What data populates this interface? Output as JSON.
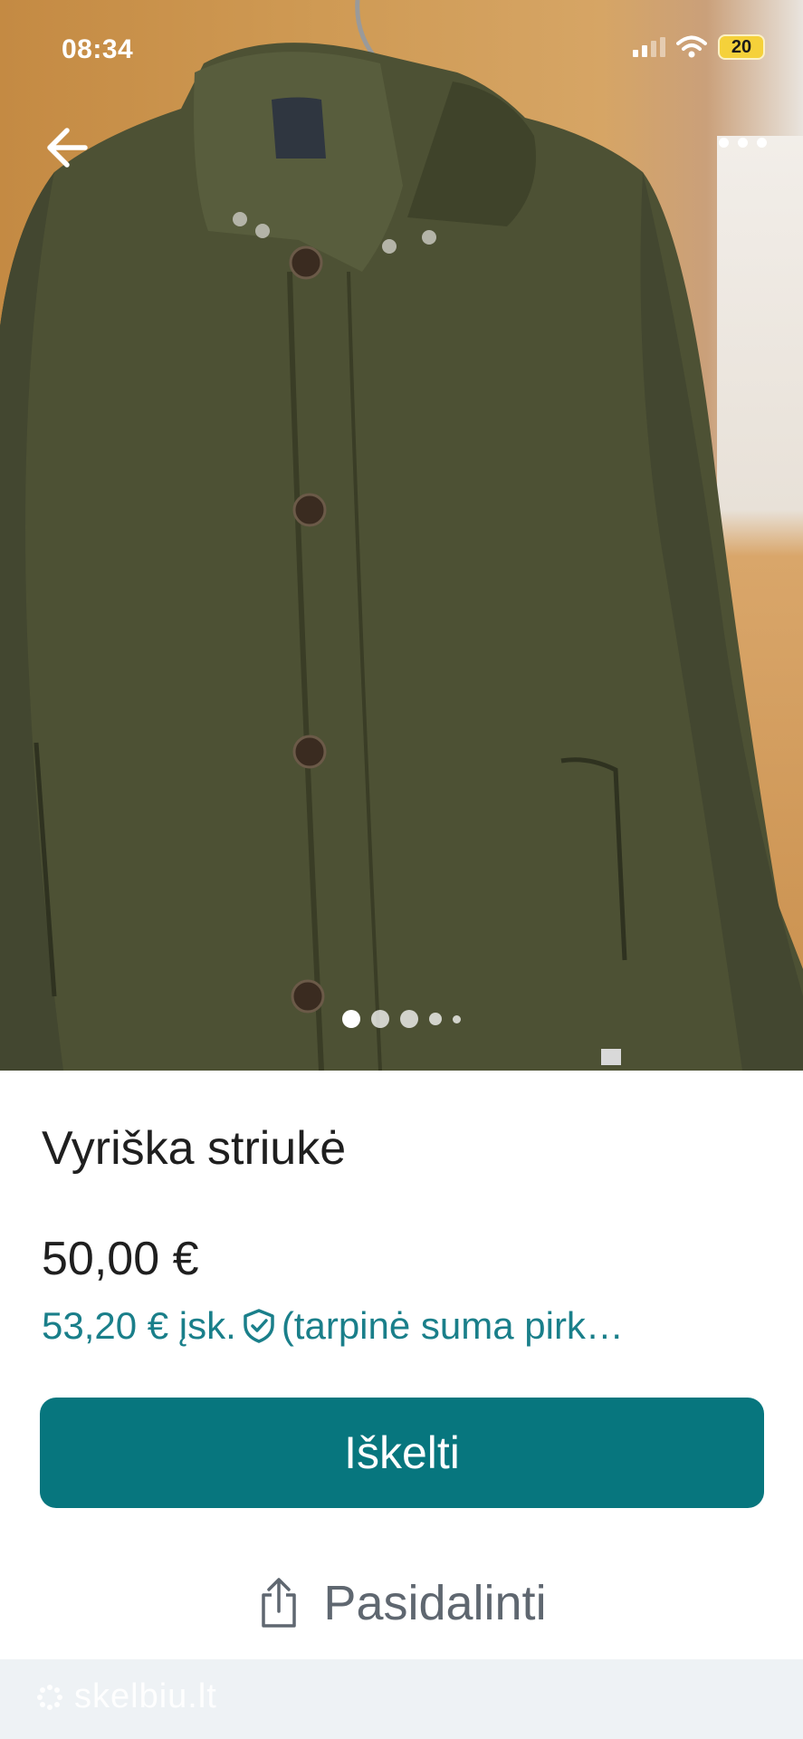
{
  "status_bar": {
    "time": "08:34",
    "battery": "20"
  },
  "nav": {
    "back_icon": "arrow-left-icon",
    "more_icon": "more-dots-icon"
  },
  "gallery": {
    "image_count": 5,
    "active_index": 0
  },
  "listing": {
    "title": "Vyriška striukė",
    "price": "50,00 €",
    "total_price": "53,20 € įsk.",
    "total_note": "(tarpinė suma pirk…",
    "protection_icon": "shield-check-icon"
  },
  "actions": {
    "primary_label": "Iškelti",
    "share_label": "Pasidalinti",
    "share_icon": "share-icon"
  },
  "footer": {
    "brand": "skelbiu.lt"
  },
  "colors": {
    "accent": "#07767e",
    "accent_text": "#1a7f8a",
    "footer_bg": "#eef2f5"
  }
}
